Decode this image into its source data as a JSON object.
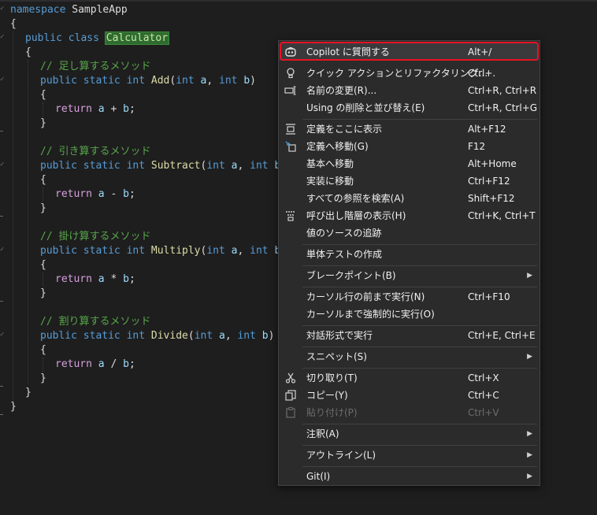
{
  "code": {
    "namespace_kw": "namespace",
    "namespace_name": "SampleApp",
    "open_brace": "{",
    "close_brace": "}",
    "class_modifiers": "public class",
    "class_name": "Calculator",
    "methods": [
      {
        "comment": "// 足し算するメソッド",
        "modifiers": "public static int",
        "name": "Add",
        "op": "+"
      },
      {
        "comment": "// 引き算するメソッド",
        "modifiers": "public static int",
        "name": "Subtract",
        "op": "-"
      },
      {
        "comment": "// 掛け算するメソッド",
        "modifiers": "public static int",
        "name": "Multiply",
        "op": "*"
      },
      {
        "comment": "// 割り算するメソッド",
        "modifiers": "public static int",
        "name": "Divide",
        "op": "/"
      }
    ],
    "param_type": "int",
    "param_a": "a",
    "param_b": "b",
    "return_kw": "return"
  },
  "context_menu": {
    "items": [
      {
        "icon": "copilot-icon",
        "label": "Copilot に質問する",
        "shortcut": "Alt+/",
        "highlighted": true
      },
      {
        "icon": "lightbulb-icon",
        "label": "クイック アクションとリファクタリング...",
        "shortcut": "Ctrl+."
      },
      {
        "icon": "rename-icon",
        "label": "名前の変更(R)...",
        "shortcut": "Ctrl+R, Ctrl+R"
      },
      {
        "icon": "",
        "label": "Using の削除と並び替え(E)",
        "shortcut": "Ctrl+R, Ctrl+G"
      },
      {
        "icon": "peek-definition-icon",
        "label": "定義をここに表示",
        "shortcut": "Alt+F12"
      },
      {
        "icon": "go-to-definition-icon",
        "label": "定義へ移動(G)",
        "shortcut": "F12"
      },
      {
        "icon": "",
        "label": "基本へ移動",
        "shortcut": "Alt+Home"
      },
      {
        "icon": "",
        "label": "実装に移動",
        "shortcut": "Ctrl+F12"
      },
      {
        "icon": "",
        "label": "すべての参照を検索(A)",
        "shortcut": "Shift+F12"
      },
      {
        "icon": "call-hierarchy-icon",
        "label": "呼び出し階層の表示(H)",
        "shortcut": "Ctrl+K, Ctrl+T"
      },
      {
        "icon": "",
        "label": "値のソースの追跡",
        "shortcut": ""
      },
      {
        "icon": "",
        "label": "単体テストの作成",
        "shortcut": ""
      },
      {
        "icon": "",
        "label": "ブレークポイント(B)",
        "shortcut": "",
        "submenu": true
      },
      {
        "icon": "",
        "label": "カーソル行の前まで実行(N)",
        "shortcut": "Ctrl+F10"
      },
      {
        "icon": "",
        "label": "カーソルまで強制的に実行(O)",
        "shortcut": ""
      },
      {
        "icon": "",
        "label": "対話形式で実行",
        "shortcut": "Ctrl+E, Ctrl+E"
      },
      {
        "icon": "",
        "label": "スニペット(S)",
        "shortcut": "",
        "submenu": true
      },
      {
        "icon": "scissors-icon",
        "label": "切り取り(T)",
        "shortcut": "Ctrl+X"
      },
      {
        "icon": "copy-icon",
        "label": "コピー(Y)",
        "shortcut": "Ctrl+C"
      },
      {
        "icon": "paste-icon",
        "label": "貼り付け(P)",
        "shortcut": "Ctrl+V",
        "disabled": true
      },
      {
        "icon": "",
        "label": "注釈(A)",
        "shortcut": "",
        "submenu": true
      },
      {
        "icon": "",
        "label": "アウトライン(L)",
        "shortcut": "",
        "submenu": true
      },
      {
        "icon": "",
        "label": "Git(I)",
        "shortcut": "",
        "submenu": true
      }
    ],
    "submenu_arrow": "▶"
  },
  "colors": {
    "keyword": "#569cd6",
    "comment": "#57a64a",
    "method": "#dcdcaa",
    "control": "#d8a0df",
    "highlight_border": "#e81123"
  }
}
